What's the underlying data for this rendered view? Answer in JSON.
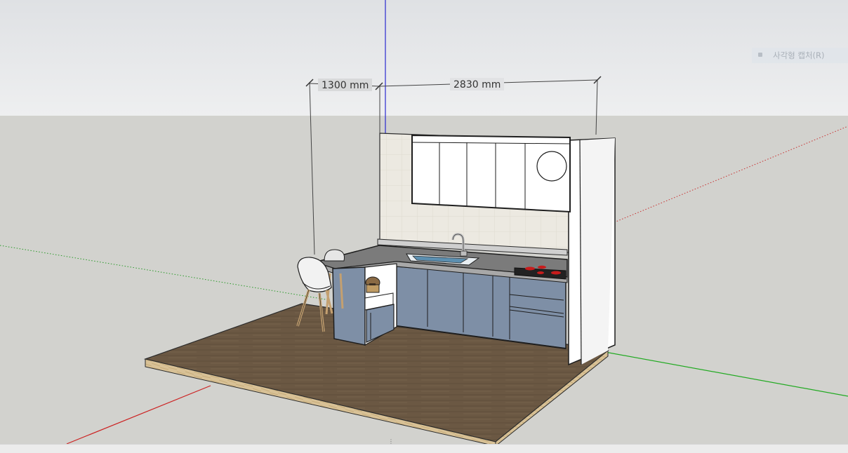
{
  "dimensions": {
    "left_label": "1300 mm",
    "right_label": "2830 mm"
  },
  "tooltip": {
    "label": "사각형 캡처(R)",
    "icon": "rectangle-capture-icon"
  },
  "colors": {
    "sky": "#e8eaec",
    "ground": "#d2d2ce",
    "floor_top": "#6d5a45",
    "floor_edge": "#d7c094",
    "cabinet": "#7e8fa6",
    "countertop": "#7b7b7b",
    "wall_tile": "#ece9e1",
    "red_axis": "#cc2222",
    "green_axis": "#22aa22",
    "blue_axis": "#2222cc"
  }
}
